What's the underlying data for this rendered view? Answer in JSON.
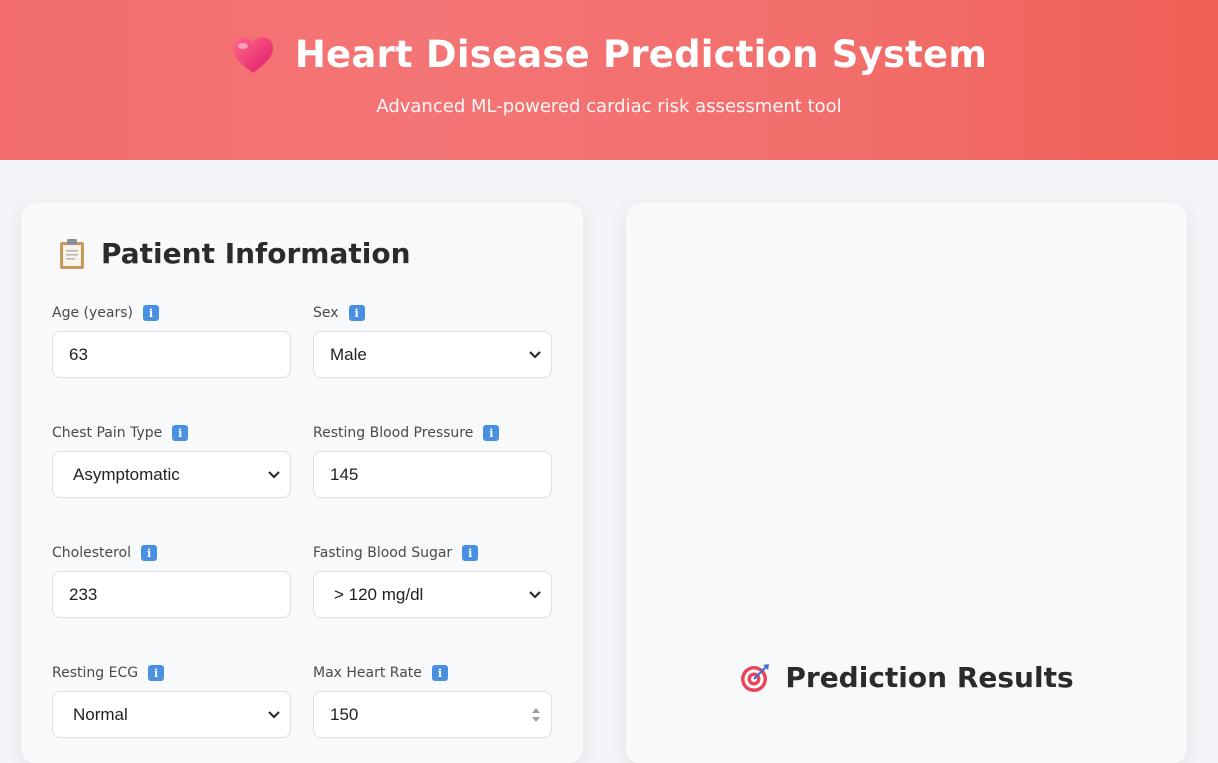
{
  "header": {
    "title": "Heart Disease Prediction System",
    "subtitle": "Advanced ML-powered cardiac risk assessment tool",
    "icon": "heart-icon"
  },
  "patient_info": {
    "title": "Patient Information",
    "icon": "clipboard-icon",
    "fields": {
      "age": {
        "label": "Age (years)",
        "value": "63"
      },
      "sex": {
        "label": "Sex",
        "value": "Male"
      },
      "chest_pain": {
        "label": "Chest Pain Type",
        "value": "Asymptomatic"
      },
      "resting_bp": {
        "label": "Resting Blood Pressure",
        "value": "145"
      },
      "cholesterol": {
        "label": "Cholesterol",
        "value": "233"
      },
      "fasting_bs": {
        "label": "Fasting Blood Sugar",
        "value": "> 120 mg/dl"
      },
      "resting_ecg": {
        "label": "Resting ECG",
        "value": "Normal"
      },
      "max_hr": {
        "label": "Max Heart Rate",
        "value": "150"
      }
    },
    "info_icon_glyph": "i"
  },
  "results": {
    "title": "Prediction Results",
    "icon": "target-icon"
  },
  "colors": {
    "header_gradient_start": "#f36d6d",
    "header_gradient_end": "#ef5f55",
    "info_badge": "#4a90e2",
    "page_bg": "#f3f4f7"
  }
}
